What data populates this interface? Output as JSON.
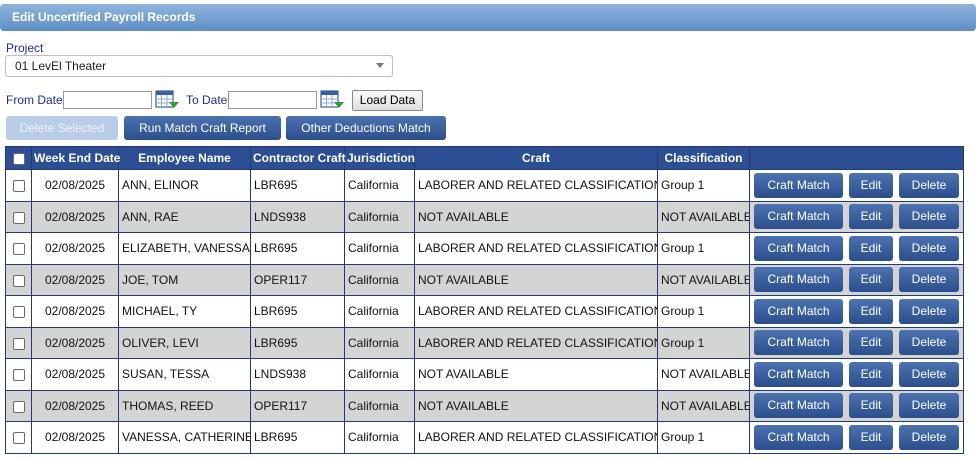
{
  "header": {
    "title": "Edit Uncertified Payroll Records"
  },
  "project": {
    "label": "Project",
    "selected": "01 LevEl Theater"
  },
  "dates": {
    "from_label": "From Date",
    "to_label": "To Date",
    "from_value": "",
    "to_value": ""
  },
  "buttons": {
    "load": "Load Data",
    "delete_selected": "Delete Selected",
    "run_match": "Run Match Craft Report",
    "other_deductions": "Other Deductions Match"
  },
  "table": {
    "columns": [
      "Week End Date",
      "Employee Name",
      "Contractor Craft",
      "Jurisdiction",
      "Craft",
      "Classification"
    ],
    "row_buttons": {
      "craft_match": "Craft Match",
      "edit": "Edit",
      "delete": "Delete"
    },
    "rows": [
      {
        "date": "02/08/2025",
        "name": "ANN, ELINOR",
        "contractor_craft": "LBR695",
        "jurisdiction": "California",
        "craft": "LABORER AND RELATED CLASSIFICATIONS",
        "classification": "Group 1"
      },
      {
        "date": "02/08/2025",
        "name": "ANN, RAE",
        "contractor_craft": "LNDS938",
        "jurisdiction": "California",
        "craft": "NOT AVAILABLE",
        "classification": "NOT AVAILABLE"
      },
      {
        "date": "02/08/2025",
        "name": "ELIZABETH, VANESSA",
        "contractor_craft": "LBR695",
        "jurisdiction": "California",
        "craft": "LABORER AND RELATED CLASSIFICATIONS",
        "classification": "Group 1"
      },
      {
        "date": "02/08/2025",
        "name": "JOE, TOM",
        "contractor_craft": "OPER117",
        "jurisdiction": "California",
        "craft": "NOT AVAILABLE",
        "classification": "NOT AVAILABLE"
      },
      {
        "date": "02/08/2025",
        "name": "MICHAEL, TY",
        "contractor_craft": "LBR695",
        "jurisdiction": "California",
        "craft": "LABORER AND RELATED CLASSIFICATIONS",
        "classification": "Group 1"
      },
      {
        "date": "02/08/2025",
        "name": "OLIVER, LEVI",
        "contractor_craft": "LBR695",
        "jurisdiction": "California",
        "craft": "LABORER AND RELATED CLASSIFICATIONS",
        "classification": "Group 1"
      },
      {
        "date": "02/08/2025",
        "name": "SUSAN, TESSA",
        "contractor_craft": "LNDS938",
        "jurisdiction": "California",
        "craft": "NOT AVAILABLE",
        "classification": "NOT AVAILABLE"
      },
      {
        "date": "02/08/2025",
        "name": "THOMAS, REED",
        "contractor_craft": "OPER117",
        "jurisdiction": "California",
        "craft": "NOT AVAILABLE",
        "classification": "NOT AVAILABLE"
      },
      {
        "date": "02/08/2025",
        "name": "VANESSA, CATHERINE",
        "contractor_craft": "LBR695",
        "jurisdiction": "California",
        "craft": "LABORER AND RELATED CLASSIFICATIONS",
        "classification": "Group 1"
      }
    ]
  },
  "colors": {
    "header_blue": "#2d4e92",
    "button_blue": "#3a5fa0",
    "alt_row": "#d4d4d4",
    "label_blue": "#1d2e8c"
  },
  "icons": {
    "calendar": "calendar-icon",
    "dropdown": "chevron-down-icon",
    "checkbox": "checkbox"
  }
}
